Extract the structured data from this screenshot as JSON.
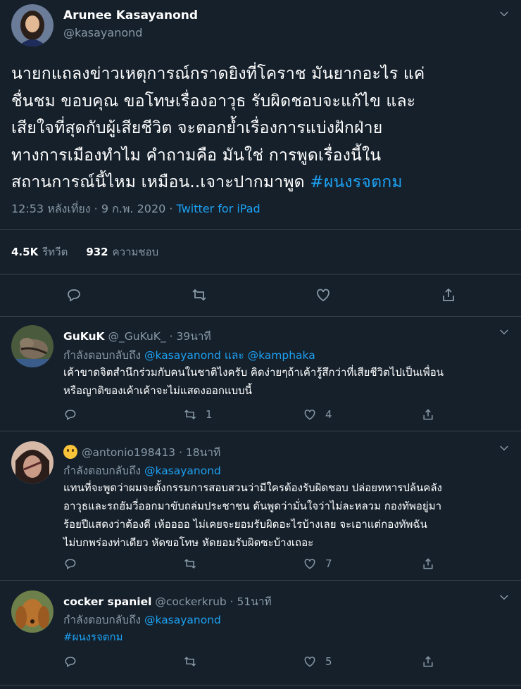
{
  "main_tweet": {
    "author_name": "Arunee Kasayanond",
    "author_handle": "@kasayanond",
    "text_lines": [
      "นายกแถลงข่าวเหตุการณ์กราดยิงที่โคราช มันยากอะไร แค่",
      "ชื่นชม  ขอบคุณ ขอโทษเรื่องอาวุธ รับผิดชอบจะแก้ไข และ",
      "เสียใจที่สุดกับผู้เสียชีวิต จะตอกย้ำเรื่องการแบ่งฝักฝ่าย",
      "ทางการเมืองทำไม คำถามคือ มันใช่ การพูดเรื่องนี้ใน",
      "สถานการณ์นี้ไหม เหมือน..เจาะปากมาพูด "
    ],
    "hashtag": "#ผนงรจตกม",
    "timestamp": "12:53 หลังเที่ยง · 9 ก.พ. 2020 · ",
    "source": "Twitter for iPad",
    "retweets_value": "4.5K",
    "retweets_label": "รีทวีต",
    "likes_value": "932",
    "likes_label": "ความชอบ"
  },
  "replies": [
    {
      "name": "GuKuK",
      "handle": "@_GuKuK_ · 39นาที",
      "reply_prefix": "กำลังตอบกลับถึง ",
      "reply_to": "@kasayanond และ @kamphaka",
      "body_lines": [
        "เค้าขาดจิตสำนึกร่วมกับคนในชาติไงครับ คิดง่ายๆถ้าเค้ารู้สึกว่าที่เสียชีวิตไปเป็นเพื่อน",
        "หรือญาติของเค้าเค้าจะไม่แสดงออกแบบนี้"
      ],
      "retweet_count": "1",
      "like_count": "4"
    },
    {
      "name": "",
      "handle": "@antonio198413 · 18นาที",
      "reply_prefix": "กำลังตอบกลับถึง ",
      "reply_to": "@kasayanond",
      "body_lines": [
        "แทนที่จะพูดว่าผมจะตั้งกรรมการสอบสวนว่ามีใครต้องรับผิดชอบ ปล่อยทหารปล้นคลัง",
        "อาวุธและรถฮัมวี่ออกมาขับถล่มประชาชน ดันพูดว่ามั่นใจว่าไม่ละหลวม กองทัพอยู่มา",
        "ร้อยปีแสดงว่าต้องดี เห้ออออ ไม่เคยจะยอมรับผิดอะไรบ้างเลย จะเอาแต่กองทัพฉัน",
        "ไม่บกพร่องท่าเดียว หัดขอโทษ หัดยอมรับผิดซะบ้างเถอะ"
      ],
      "retweet_count": "",
      "like_count": "7"
    },
    {
      "name": "cocker spaniel",
      "handle": "@cockerkrub · 51นาที",
      "reply_prefix": "กำลังตอบกลับถึง ",
      "reply_to": "@kasayanond",
      "body_lines": [
        "#ผนงรจตกม"
      ],
      "retweet_count": "",
      "like_count": "5"
    }
  ],
  "colors": {
    "background": "#15202b",
    "divider": "#38444d",
    "secondary_text": "#8899a6",
    "link": "#1da1f2"
  },
  "icons": [
    "chevron-down-icon",
    "reply-icon",
    "retweet-icon",
    "like-icon",
    "share-icon",
    "smiling-face-emoji"
  ]
}
